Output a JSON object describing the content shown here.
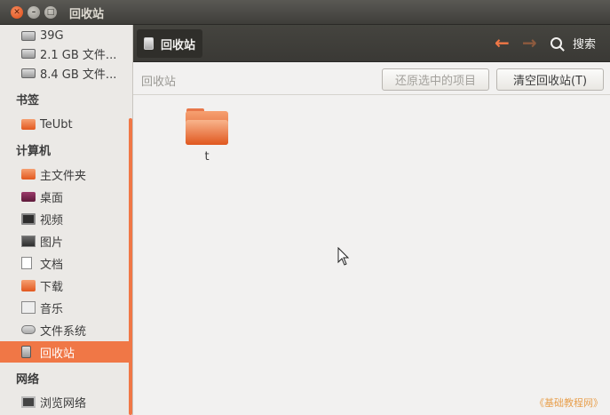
{
  "window": {
    "title": "回收站"
  },
  "sidebar": {
    "devices": [
      {
        "label": "39G",
        "icon": "drive-icon"
      },
      {
        "label": "2.1 GB 文件...",
        "icon": "drive-icon"
      },
      {
        "label": "8.4 GB 文件...",
        "icon": "drive-icon"
      }
    ],
    "bookmarks_header": "书签",
    "bookmarks": [
      {
        "label": "TeUbt",
        "icon": "folder-icon"
      }
    ],
    "computer_header": "计算机",
    "computer": [
      {
        "label": "主文件夹",
        "icon": "home-folder-icon"
      },
      {
        "label": "桌面",
        "icon": "desktop-icon"
      },
      {
        "label": "视频",
        "icon": "video-icon"
      },
      {
        "label": "图片",
        "icon": "picture-icon"
      },
      {
        "label": "文档",
        "icon": "document-icon"
      },
      {
        "label": "下载",
        "icon": "download-icon"
      },
      {
        "label": "音乐",
        "icon": "music-icon"
      },
      {
        "label": "文件系统",
        "icon": "filesystem-icon"
      },
      {
        "label": "回收站",
        "icon": "trash-icon"
      }
    ],
    "network_header": "网络",
    "network": [
      {
        "label": "浏览网络",
        "icon": "network-icon"
      }
    ]
  },
  "toolbar": {
    "path_label": "回收站",
    "search_label": "搜索"
  },
  "infobar": {
    "title": "回收站",
    "restore_label": "还原选中的项目",
    "empty_label": "清空回收站(T)"
  },
  "files": [
    {
      "name": "t",
      "icon": "folder-icon"
    }
  ],
  "watermark": "《基础教程网》",
  "colors": {
    "accent": "#f07746",
    "titlebar": "#3c3b37",
    "content_bg": "#f2f1f0"
  }
}
